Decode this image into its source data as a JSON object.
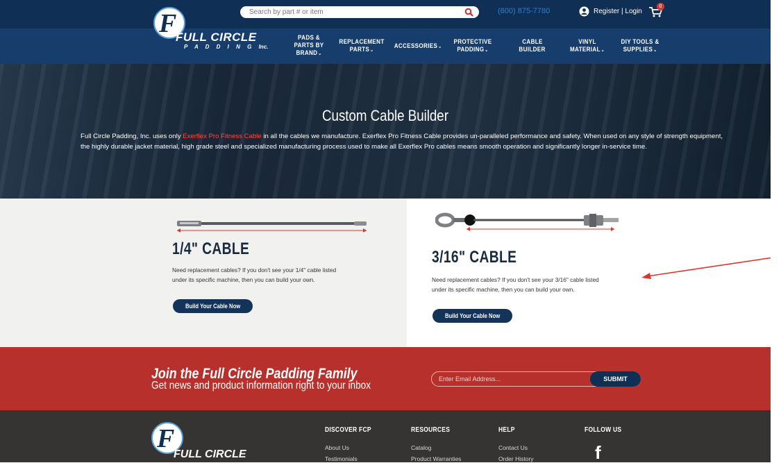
{
  "header": {
    "logo": {
      "name": "FULL CIRCLE",
      "sub": "P A D D I N G",
      "suffix": "Inc."
    },
    "search_placeholder": "Search by part # or item",
    "phone": "(800) 875-7780",
    "account": "Register | Login",
    "cart_count": "0"
  },
  "nav": [
    {
      "label": "PADS &\nPARTS BY\nBRAND",
      "chevron": "⌄"
    },
    {
      "label": "REPLACEMENT\nPARTS",
      "chevron": "⌄"
    },
    {
      "label": "ACCESSORIES",
      "chevron": "⌄"
    },
    {
      "label": "PROTECTIVE\nPADDING",
      "chevron": "⌄"
    },
    {
      "label": "CABLE\nBUILDER",
      "chevron": ""
    },
    {
      "label": "VINYL\nMATERIAL",
      "chevron": "⌄"
    },
    {
      "label": "DIY TOOLS &\nSUPPLIES",
      "chevron": "⌄"
    }
  ],
  "hero": {
    "title": "Custom Cable Builder",
    "text_before": "Full Circle Padding, Inc. uses only ",
    "link": "Exerflex Pro Fitness Cable",
    "text_after": " in all the cables we manufacture. Exerflex Pro Fitness Cable provides un-paralleled performance and safety. When used on any style of strength equipment, the highly durable jacket material, high grade steel and specialized manufacturing process used to make all Exerflex Pro cables means smooth operation and significantly longer in-service time."
  },
  "cables": [
    {
      "title": "1/4\" CABLE",
      "desc1": "Need replacement cables? If you don't see your 1/4\" cable listed",
      "desc2": "under its specific machine, then you can build your own.",
      "button": "Build Your Cable Now"
    },
    {
      "title": "3/16\" CABLE",
      "desc1": "Need replacement cables? If you don't see your 3/16\" cable listed",
      "desc2": "under its specific machine, then you can build your own.",
      "button": "Build Your Cable Now"
    }
  ],
  "newsletter": {
    "title": "Join the Full Circle Padding Family",
    "subtitle": "Get news and product information right to your inbox",
    "email_placeholder": "Enter Email Address...",
    "submit": "SUBMIT"
  },
  "footer": {
    "logo_name": "FULL CIRCLE",
    "columns": [
      {
        "heading": "DISCOVER FCP",
        "links": [
          "About Us",
          "Testimonials"
        ]
      },
      {
        "heading": "RESOURCES",
        "links": [
          "Catalog",
          "Product Warranties"
        ]
      },
      {
        "heading": "HELP",
        "links": [
          "Contact Us",
          "Order History"
        ]
      },
      {
        "heading": "FOLLOW US",
        "links": []
      }
    ],
    "facebook": "f"
  },
  "colors": {
    "navy": "#0f2f55",
    "nav_blue": "#173d6c",
    "red": "#b8302b",
    "link_red": "#ff4b3e",
    "phone_blue": "#2d7fd1",
    "footer_bg": "#363433"
  }
}
